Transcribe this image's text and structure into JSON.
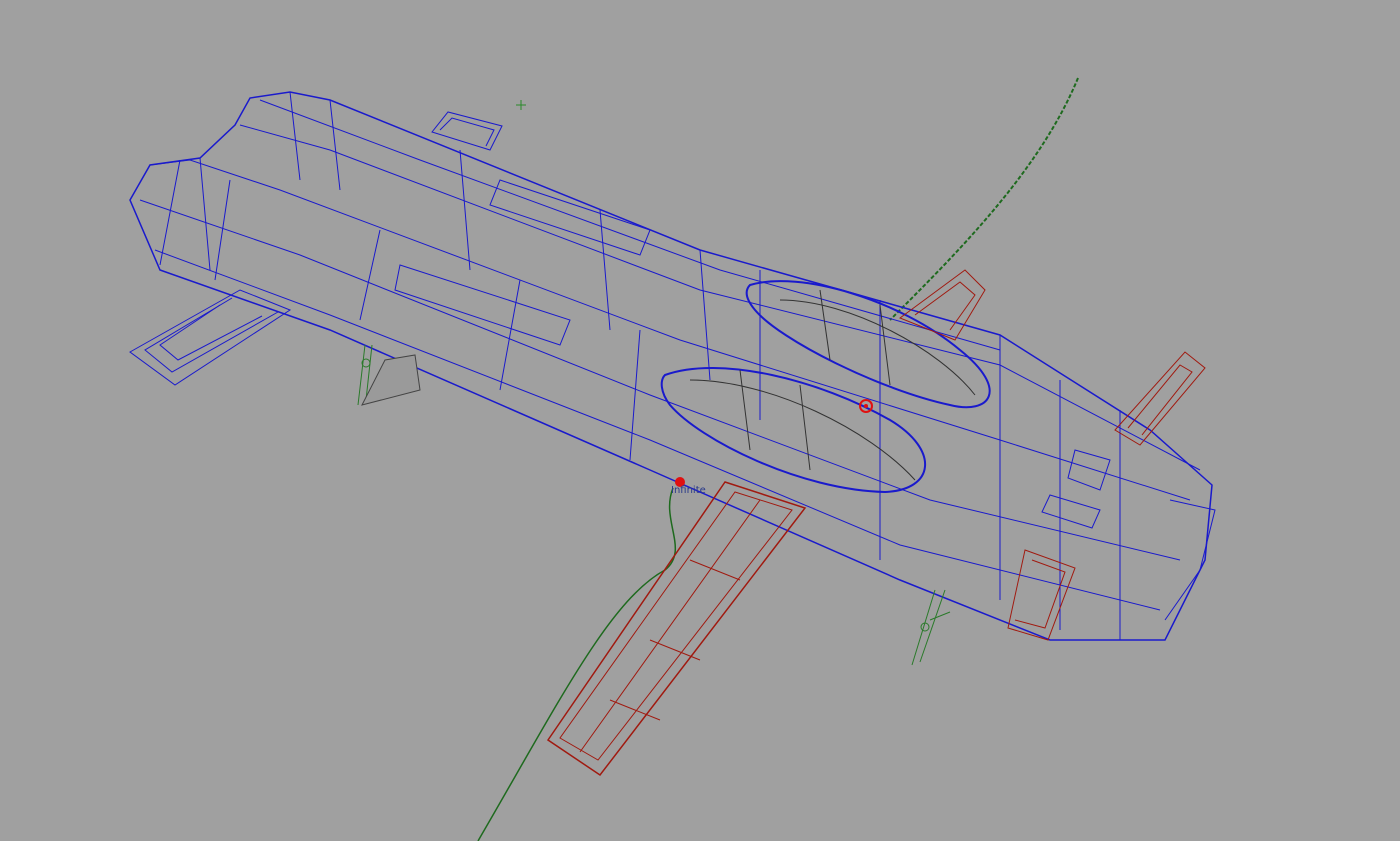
{
  "viewport": {
    "background": "#a0a0a0",
    "object_label": "Infinite",
    "colors": {
      "wireframe": "#1a1acc",
      "selected_parts": "#a01a10",
      "curve": "#1e6a1e",
      "locator": "#e01010"
    }
  }
}
